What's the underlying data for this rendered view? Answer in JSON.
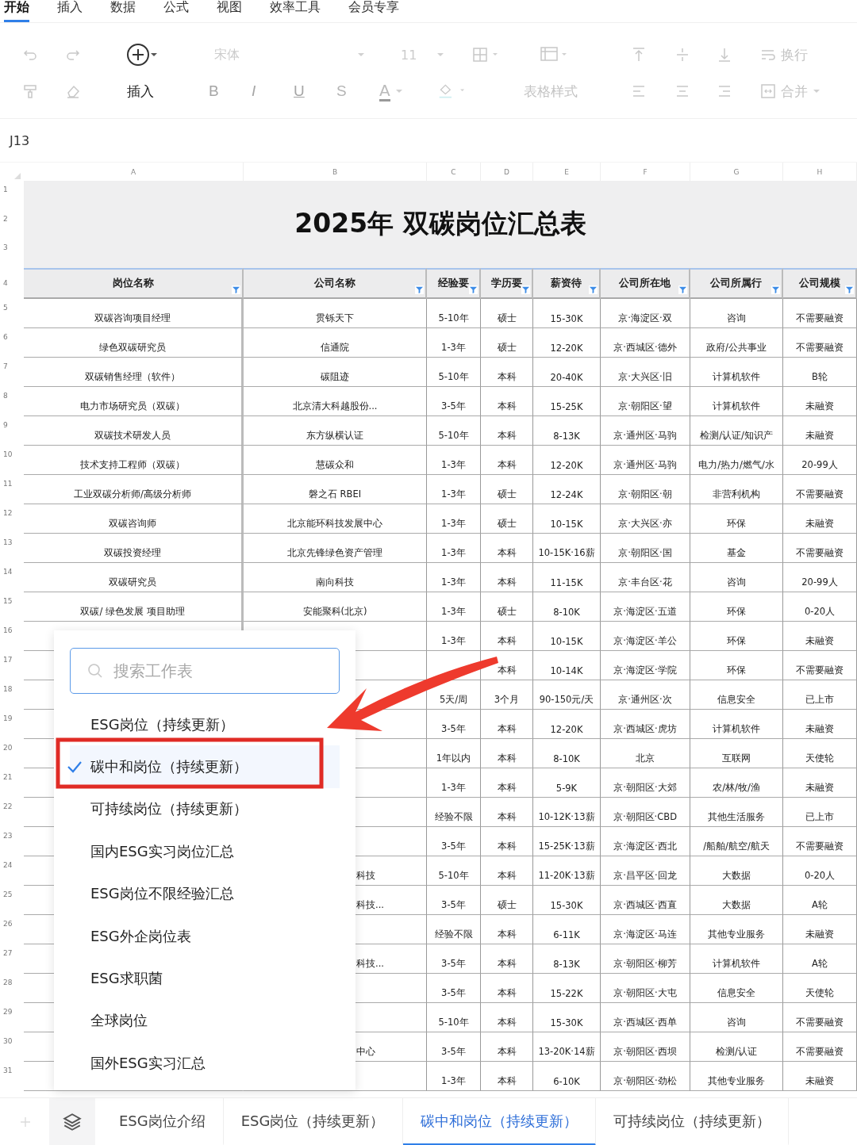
{
  "menu_tabs": [
    {
      "label": "开始",
      "selected": true
    },
    {
      "label": "插入",
      "selected": false
    },
    {
      "label": "数据",
      "selected": false
    },
    {
      "label": "公式",
      "selected": false
    },
    {
      "label": "视图",
      "selected": false
    },
    {
      "label": "效率工具",
      "selected": false
    },
    {
      "label": "会员专享",
      "selected": false
    }
  ],
  "toolbar": {
    "font": "宋体",
    "font_size": "11",
    "insert_label": "插入",
    "format_letters": [
      "B",
      "I",
      "U",
      "S"
    ],
    "font_color_letter": "A",
    "table_style": "表格样式",
    "wrap": "换行",
    "merge": "合并"
  },
  "name_box": "J13",
  "column_letters": [
    "A",
    "B",
    "C",
    "D",
    "E",
    "F",
    "G",
    "H"
  ],
  "sheet": {
    "title": "2025年 双碳岗位汇总表",
    "title_row_numbers": [
      "1",
      "2",
      "3"
    ],
    "header_row_number": "4",
    "headers": [
      "岗位名称",
      "公司名称",
      "经验要",
      "学历要",
      "薪资待",
      "公司所在地",
      "公司所属行",
      "公司规模"
    ],
    "rows": [
      {
        "number": "5",
        "kind": "full",
        "cells": [
          "双碳咨询项目经理",
          "贯铄天下",
          "5-10年",
          "硕士",
          "15-30K",
          "京·海淀区·双",
          "咨询",
          "不需要融资"
        ]
      },
      {
        "number": "6",
        "kind": "full",
        "cells": [
          "绿色双碳研究员",
          "信通院",
          "1-3年",
          "硕士",
          "12-20K",
          "京·西城区·德外",
          "政府/公共事业",
          "不需要融资"
        ]
      },
      {
        "number": "7",
        "kind": "full",
        "cells": [
          "双碳销售经理（软件）",
          "碳阻迹",
          "5-10年",
          "本科",
          "20-40K",
          "京·大兴区·旧",
          "计算机软件",
          "B轮"
        ]
      },
      {
        "number": "8",
        "kind": "full",
        "cells": [
          "电力市场研究员（双碳）",
          "北京清大科越股份...",
          "3-5年",
          "本科",
          "15-25K",
          "京·朝阳区·望",
          "计算机软件",
          "未融资"
        ]
      },
      {
        "number": "9",
        "kind": "full",
        "cells": [
          "双碳技术研发人员",
          "东方纵横认证",
          "5-10年",
          "本科",
          "8-13K",
          "京·通州区·马驹",
          "检测/认证/知识产",
          "未融资"
        ]
      },
      {
        "number": "10",
        "kind": "full",
        "cells": [
          "技术支持工程师（双碳）",
          "慧碳众和",
          "1-3年",
          "本科",
          "12-20K",
          "京·通州区·马驹",
          "电力/热力/燃气/水",
          "20-99人"
        ]
      },
      {
        "number": "11",
        "kind": "full",
        "cells": [
          "工业双碳分析师/高级分析师",
          "磐之石 RBEI",
          "1-3年",
          "硕士",
          "12-24K",
          "京·朝阳区·朝",
          "非营利机构",
          "不需要融资"
        ]
      },
      {
        "number": "12",
        "kind": "full",
        "cells": [
          "双碳咨询师",
          "北京能环科技发展中心",
          "1-3年",
          "硕士",
          "10-15K",
          "京·大兴区·亦",
          "环保",
          "未融资"
        ]
      },
      {
        "number": "13",
        "kind": "full",
        "cells": [
          "双碳投资经理",
          "北京先锋绿色资产管理",
          "1-3年",
          "本科",
          "10-15K·16薪",
          "京·朝阳区·国",
          "基金",
          "不需要融资"
        ]
      },
      {
        "number": "14",
        "kind": "full",
        "cells": [
          "双碳研究员",
          "南向科技",
          "1-3年",
          "本科",
          "11-15K",
          "京·丰台区·花",
          "咨询",
          "20-99人"
        ]
      },
      {
        "number": "15",
        "kind": "full",
        "cells": [
          "双碳/ 绿色发展 项目助理",
          "安能聚科(北京)",
          "1-3年",
          "硕士",
          "8-10K",
          "京·海淀区·五道",
          "环保",
          "0-20人"
        ]
      },
      {
        "number": "16",
        "kind": "partial",
        "cells": [
          null,
          null,
          "1-3年",
          "本科",
          "10-15K",
          "京·海淀区·羊公",
          "环保",
          "未融资"
        ]
      },
      {
        "number": "17",
        "kind": "partial",
        "cells": [
          null,
          null,
          null,
          "本科",
          "10-14K",
          "京·海淀区·学院",
          "环保",
          "不需要融资"
        ]
      },
      {
        "number": "18",
        "kind": "partial",
        "cells": [
          null,
          null,
          "5天/周",
          "3个月",
          "90-150元/天",
          "京·通州区·次",
          "信息安全",
          "已上市"
        ]
      },
      {
        "number": "19",
        "kind": "partial",
        "cells": [
          null,
          null,
          "3-5年",
          "本科",
          "12-20K",
          "京·西城区·虎坊",
          "计算机软件",
          "未融资"
        ]
      },
      {
        "number": "20",
        "kind": "partial",
        "cells": [
          null,
          null,
          "1年以内",
          "本科",
          "8-10K",
          "北京",
          "互联网",
          "天使轮"
        ]
      },
      {
        "number": "21",
        "kind": "partial",
        "cells": [
          null,
          null,
          "1-3年",
          "本科",
          "5-9K",
          "京·朝阳区·大郊",
          "农/林/牧/渔",
          "未融资"
        ]
      },
      {
        "number": "22",
        "kind": "partial",
        "cells": [
          null,
          null,
          "经验不限",
          "本科",
          "10-12K·13薪",
          "京·朝阳区·CBD",
          "其他生活服务",
          "已上市"
        ]
      },
      {
        "number": "23",
        "kind": "partial",
        "cells": [
          null,
          null,
          "3-5年",
          "本科",
          "15-25K·13薪",
          "京·海淀区·西北",
          "/船舶/航空/航天",
          "不需要融资"
        ]
      },
      {
        "number": "24",
        "kind": "partial",
        "cells": [
          null,
          "科技",
          "5-10年",
          "本科",
          "11-20K·13薪",
          "京·昌平区·回龙",
          "大数据",
          "0-20人"
        ]
      },
      {
        "number": "25",
        "kind": "partial",
        "cells": [
          null,
          "科技...",
          "3-5年",
          "硕士",
          "15-30K",
          "京·西城区·西直",
          "大数据",
          "A轮"
        ]
      },
      {
        "number": "26",
        "kind": "partial",
        "cells": [
          null,
          null,
          "经验不限",
          "本科",
          "6-11K",
          "京·海淀区·马连",
          "其他专业服务",
          "未融资"
        ]
      },
      {
        "number": "27",
        "kind": "partial",
        "cells": [
          null,
          "科技...",
          "3-5年",
          "本科",
          "8-13K",
          "京·朝阳区·柳芳",
          "计算机软件",
          "A轮"
        ]
      },
      {
        "number": "28",
        "kind": "partial",
        "cells": [
          null,
          null,
          "3-5年",
          "本科",
          "15-22K",
          "京·朝阳区·大屯",
          "信息安全",
          "天使轮"
        ]
      },
      {
        "number": "29",
        "kind": "partial",
        "cells": [
          null,
          null,
          "5-10年",
          "本科",
          "15-30K",
          "京·西城区·西单",
          "咨询",
          "不需要融资"
        ]
      },
      {
        "number": "30",
        "kind": "partial",
        "cells": [
          null,
          "中心",
          "3-5年",
          "本科",
          "13-20K·14薪",
          "京·朝阳区·西坝",
          "检测/认证",
          "不需要融资"
        ]
      },
      {
        "number": "31",
        "kind": "partial",
        "cells": [
          null,
          null,
          "1-3年",
          "本科",
          "6-10K",
          "京·朝阳区·劲松",
          "其他专业服务",
          "未融资"
        ]
      }
    ]
  },
  "sheet_menu": {
    "placeholder": "搜索工作表",
    "items": [
      {
        "label": "ESG岗位（持续更新）",
        "selected": false
      },
      {
        "label": "碳中和岗位（持续更新）",
        "selected": true
      },
      {
        "label": "可持续岗位（持续更新）",
        "selected": false
      },
      {
        "label": "国内ESG实习岗位汇总",
        "selected": false
      },
      {
        "label": "ESG岗位不限经验汇总",
        "selected": false
      },
      {
        "label": "ESG外企岗位表",
        "selected": false
      },
      {
        "label": "ESG求职菌",
        "selected": false
      },
      {
        "label": "全球岗位",
        "selected": false
      },
      {
        "label": "国外ESG实习汇总",
        "selected": false
      }
    ]
  },
  "sheet_tabs": [
    {
      "label": "ESG岗位介绍",
      "selected": false
    },
    {
      "label": "ESG岗位（持续更新）",
      "selected": false
    },
    {
      "label": "碳中和岗位（持续更新）",
      "selected": true
    },
    {
      "label": "可持续岗位（持续更新）",
      "selected": false
    }
  ]
}
